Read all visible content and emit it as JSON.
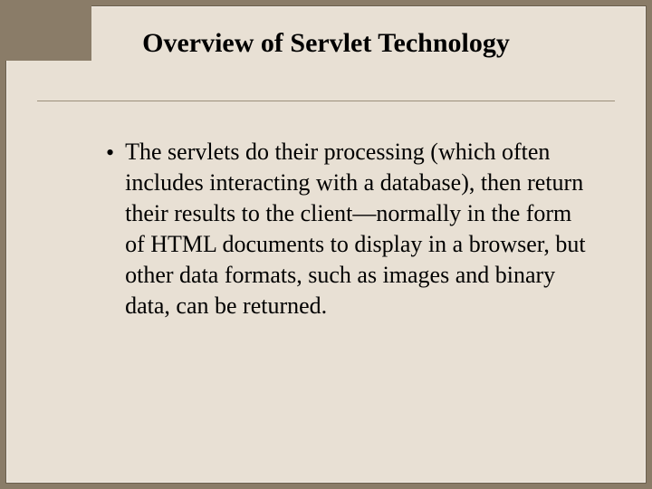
{
  "slide": {
    "title": "Overview of Servlet Technology",
    "bullets": [
      {
        "text": "The servlets do their processing (which often includes interacting with a database), then return their results to the client—normally in the form of HTML documents to display in a browser, but other data formats, such as images and binary data, can be returned."
      }
    ]
  }
}
